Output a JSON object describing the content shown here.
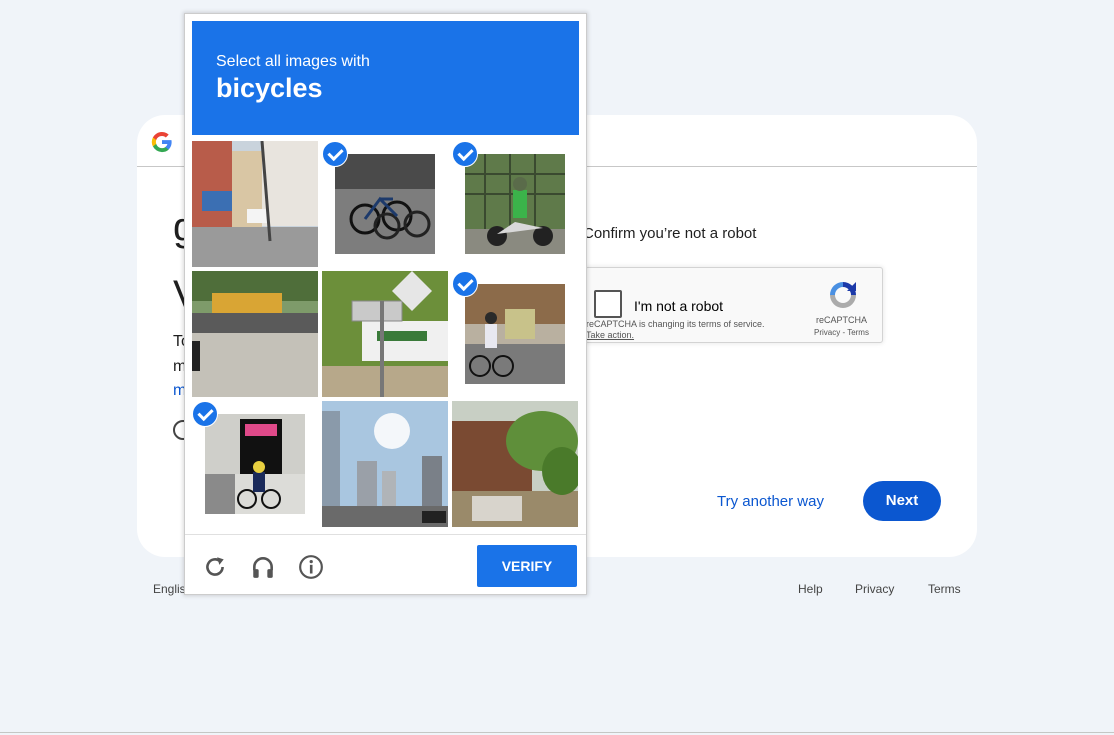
{
  "background_page": {
    "heading_glyph": "g",
    "welcome_glyph": "V",
    "text_line1": "To",
    "text_line2": "m",
    "text_link": "m",
    "confirm_text": "Confirm you’re not a robot",
    "recaptcha": {
      "checkbox_label": "I'm not a robot",
      "notice": "reCAPTCHA is changing its terms of service.",
      "take_action": "Take action.",
      "brand": "reCAPTCHA",
      "links": "Privacy - Terms"
    },
    "try_another_way": "Try another way",
    "next_label": "Next",
    "footer": {
      "language": "Englis",
      "help": "Help",
      "privacy": "Privacy",
      "terms": "Terms"
    }
  },
  "challenge": {
    "instruction": "Select all images with",
    "target": "bicycles",
    "tiles": [
      {
        "scene": "street with shops",
        "selected": false
      },
      {
        "scene": "parked bicycles",
        "selected": true
      },
      {
        "scene": "motorbike rider",
        "selected": true
      },
      {
        "scene": "bus on road",
        "selected": false
      },
      {
        "scene": "bus stop sign",
        "selected": false
      },
      {
        "scene": "cyclist on street",
        "selected": true
      },
      {
        "scene": "cyclist by storefront",
        "selected": true
      },
      {
        "scene": "city skyline street",
        "selected": false
      },
      {
        "scene": "wooden house with palms",
        "selected": false
      }
    ],
    "icons": [
      "reload-icon",
      "audio-icon",
      "info-icon"
    ],
    "verify_label": "VERIFY"
  },
  "colors": {
    "accent": "#1a73e8",
    "google_blue": "#0b57d0",
    "page_bg": "#f0f4f9"
  }
}
